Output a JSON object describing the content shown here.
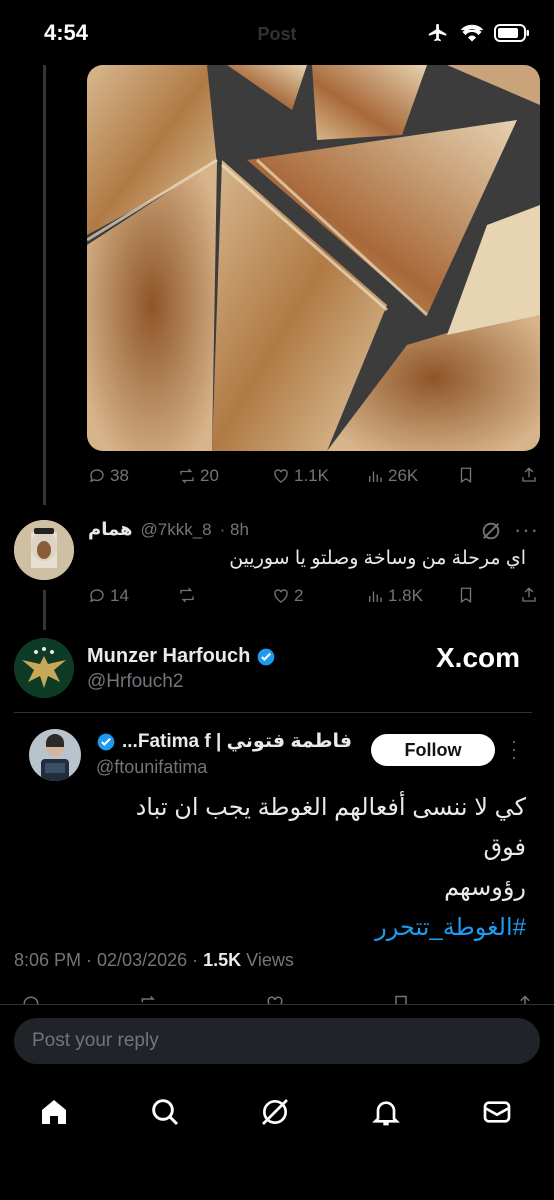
{
  "status_bar": {
    "time": "4:54",
    "title": "Post"
  },
  "parent_post": {
    "stats": {
      "replies": "38",
      "reposts": "20",
      "likes": "1.1K",
      "views": "26K"
    }
  },
  "reply": {
    "name": "همام",
    "handle": "@7kkk_8",
    "time": "· 8h",
    "text": "اي مرحلة من وساخة وصلتو يا سوريين",
    "stats": {
      "replies": "14",
      "likes": "2",
      "views": "1.8K"
    }
  },
  "main_post": {
    "name": "Munzer Harfouch",
    "handle": "@Hrfouch2",
    "watermark": "X.com",
    "embedded": {
      "name": "فاطمة فتوني | Fatima f...",
      "handle": "@ftounifatima",
      "follow_label": "Follow",
      "text_line1": "كي لا ننسى أفعالهم الغوطة يجب ان تباد فوق",
      "text_line2": "رؤوسهم",
      "hashtag": "#الغوطة_تتحرر"
    },
    "timestamp": "8:06 PM · 02/03/2026 · ",
    "views_count": "1.5K",
    "views_label": " Views"
  },
  "reply_box": {
    "placeholder": "Post your reply"
  },
  "colors": {
    "accent": "#1d9bf0",
    "background": "#000000",
    "muted": "#71767b"
  },
  "nav": [
    "home-icon",
    "search-icon",
    "grok-icon",
    "notifications-icon",
    "messages-icon"
  ]
}
